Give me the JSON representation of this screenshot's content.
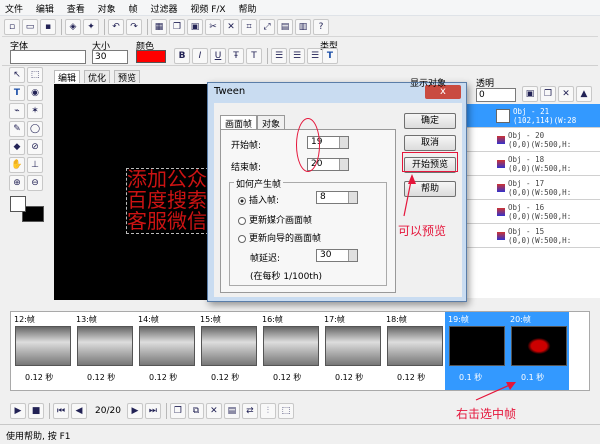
{
  "menu": [
    "文件",
    "编辑",
    "查看",
    "对象",
    "帧",
    "过滤器",
    "视频 F/X",
    "帮助"
  ],
  "toolbar2": {
    "font_label": "字体",
    "size_label": "大小",
    "size_value": "30",
    "color_label": "颜色",
    "type_label": "类型"
  },
  "tabs": [
    "编辑",
    "优化",
    "预览"
  ],
  "canvas_text": [
    "添加公众",
    "百度搜索",
    "客服微信"
  ],
  "right_panel": {
    "header": "显示对象",
    "opacity_label": "透明",
    "opacity_value": "0",
    "objects": [
      {
        "name": "Obj - 21",
        "coords": "(102,114)(W:28"
      },
      {
        "name": "Obj - 20",
        "coords": "(0,0)(W:500,H:"
      },
      {
        "name": "Obj - 18",
        "coords": "(0,0)(W:500,H:"
      },
      {
        "name": "Obj - 17",
        "coords": "(0,0)(W:500,H:"
      },
      {
        "name": "Obj - 16",
        "coords": "(0,0)(W:500,H:"
      },
      {
        "name": "Obj - 15",
        "coords": "(0,0)(W:500,H:"
      }
    ]
  },
  "dialog": {
    "title": "Tween",
    "close": "x",
    "tab_frames": "画面帧",
    "tab_objects": "对象",
    "start_label": "开始帧:",
    "start_value": "19",
    "end_label": "结束帧:",
    "end_value": "20",
    "how_label": "如何产生帧",
    "insert_label": "插入帧:",
    "insert_value": "8",
    "update_media_label": "更新媒介画面帧",
    "update_wizard_label": "更新向导的画面帧",
    "delay_label": "帧延迟:",
    "delay_value": "30",
    "delay_note": "(在每秒 1/100th)",
    "ok": "确定",
    "cancel": "取消",
    "preview": "开始预览",
    "help": "帮助"
  },
  "annotations": {
    "preview_note": "可以预览",
    "select_note": "右击选中帧"
  },
  "frames": [
    {
      "num": "12:帧",
      "dur": "0.12 秒",
      "selected": false
    },
    {
      "num": "13:帧",
      "dur": "0.12 秒",
      "selected": false
    },
    {
      "num": "14:帧",
      "dur": "0.12 秒",
      "selected": false
    },
    {
      "num": "15:帧",
      "dur": "0.12 秒",
      "selected": false
    },
    {
      "num": "16:帧",
      "dur": "0.12 秒",
      "selected": false
    },
    {
      "num": "17:帧",
      "dur": "0.12 秒",
      "selected": false
    },
    {
      "num": "18:帧",
      "dur": "0.12 秒",
      "selected": false
    },
    {
      "num": "19:帧",
      "dur": "0.1 秒",
      "selected": true
    },
    {
      "num": "20:帧",
      "dur": "0.1 秒",
      "selected": true
    }
  ],
  "playback": {
    "counter": "20/20"
  },
  "status": "使用帮助, 按 F1",
  "colors": {
    "accent": "#3399ff",
    "annotation": "#e5163b",
    "text_red": "#cc1313"
  }
}
